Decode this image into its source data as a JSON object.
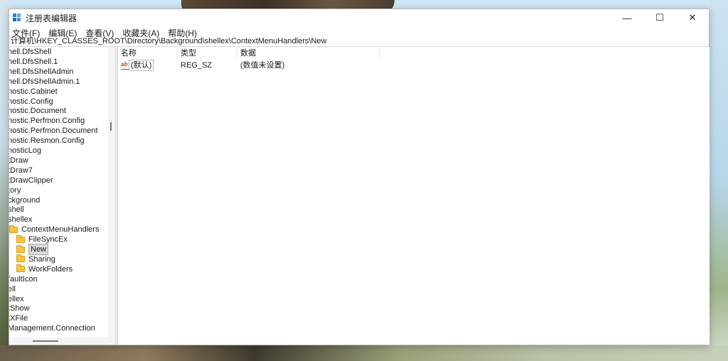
{
  "window": {
    "title": "注册表编辑器",
    "controls": {
      "minimize": "—",
      "maximize": "☐",
      "close": "✕"
    }
  },
  "menu": [
    "文件(F)",
    "编辑(E)",
    "查看(V)",
    "收藏夹(A)",
    "帮助(H)"
  ],
  "address": "计算机\\HKEY_CLASSES_ROOT\\Directory\\Background\\shellex\\ContextMenuHandlers\\New",
  "tree": [
    {
      "label": "hell.DfsShell",
      "folder": false
    },
    {
      "label": "hell.DfsShell.1",
      "folder": false
    },
    {
      "label": "hell.DfsShellAdmin",
      "folder": false
    },
    {
      "label": "hell.DfsShellAdmin.1",
      "folder": false
    },
    {
      "label": "nostic.Cabinet",
      "folder": false
    },
    {
      "label": "nostic.Config",
      "folder": false
    },
    {
      "label": "nostic.Document",
      "folder": false
    },
    {
      "label": "nostic.Perfmon.Config",
      "folder": false
    },
    {
      "label": "nostic.Perfmon.Document",
      "folder": false
    },
    {
      "label": "nostic.Resmon.Config",
      "folder": false
    },
    {
      "label": "nosticLog",
      "folder": false
    },
    {
      "label": "tDraw",
      "folder": false
    },
    {
      "label": "tDraw7",
      "folder": false
    },
    {
      "label": "tDrawClipper",
      "folder": false
    },
    {
      "label": "tory",
      "folder": false
    },
    {
      "label": "ckground",
      "folder": false
    },
    {
      "label": "shell",
      "folder": false
    },
    {
      "label": "shellex",
      "folder": false
    },
    {
      "label": "ContextMenuHandlers",
      "folder": true
    },
    {
      "label": "FileSyncEx",
      "folder": true
    },
    {
      "label": "New",
      "folder": true,
      "selected": true
    },
    {
      "label": "Sharing",
      "folder": true
    },
    {
      "label": "WorkFolders",
      "folder": true
    },
    {
      "label": "faultIcon",
      "folder": false
    },
    {
      "label": "ell",
      "folder": false
    },
    {
      "label": "ellex",
      "folder": false
    },
    {
      "label": "tShow",
      "folder": false
    },
    {
      "label": "tXFile",
      "folder": false
    },
    {
      "label": "Management.Connection",
      "folder": false
    }
  ],
  "columns": {
    "name": "名称",
    "type": "类型",
    "data": "数据"
  },
  "values": [
    {
      "icon": "ab",
      "name": "(默认)",
      "type": "REG_SZ",
      "data": "(数值未设置)"
    }
  ],
  "colors": {
    "folder": "#f6c343",
    "accent": "#2c83d6",
    "string_icon": "#c0392b"
  }
}
